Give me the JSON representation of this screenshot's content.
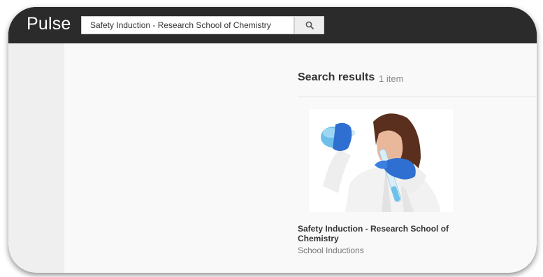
{
  "app": {
    "logo": "Pulse"
  },
  "search": {
    "value": "Safety Induction - Research School of Chemistry",
    "button_icon": "search-icon"
  },
  "results": {
    "title": "Search results",
    "count": "1 item"
  },
  "items": [
    {
      "title": "Safety Induction - Research School of Chemistry",
      "category": "School Inductions",
      "image": "scientist-with-flask-photo"
    }
  ]
}
